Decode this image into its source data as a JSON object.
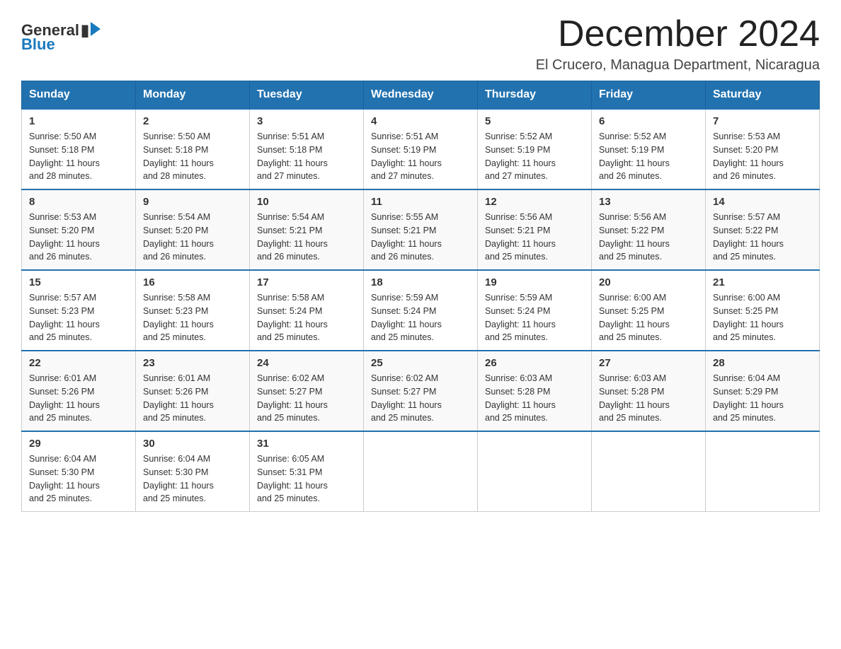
{
  "header": {
    "title": "December 2024",
    "location": "El Crucero, Managua Department, Nicaragua",
    "logo_general": "General",
    "logo_blue": "Blue"
  },
  "days_of_week": [
    "Sunday",
    "Monday",
    "Tuesday",
    "Wednesday",
    "Thursday",
    "Friday",
    "Saturday"
  ],
  "weeks": [
    [
      {
        "day": "1",
        "sunrise": "5:50 AM",
        "sunset": "5:18 PM",
        "daylight": "11 hours and 28 minutes."
      },
      {
        "day": "2",
        "sunrise": "5:50 AM",
        "sunset": "5:18 PM",
        "daylight": "11 hours and 28 minutes."
      },
      {
        "day": "3",
        "sunrise": "5:51 AM",
        "sunset": "5:18 PM",
        "daylight": "11 hours and 27 minutes."
      },
      {
        "day": "4",
        "sunrise": "5:51 AM",
        "sunset": "5:19 PM",
        "daylight": "11 hours and 27 minutes."
      },
      {
        "day": "5",
        "sunrise": "5:52 AM",
        "sunset": "5:19 PM",
        "daylight": "11 hours and 27 minutes."
      },
      {
        "day": "6",
        "sunrise": "5:52 AM",
        "sunset": "5:19 PM",
        "daylight": "11 hours and 26 minutes."
      },
      {
        "day": "7",
        "sunrise": "5:53 AM",
        "sunset": "5:20 PM",
        "daylight": "11 hours and 26 minutes."
      }
    ],
    [
      {
        "day": "8",
        "sunrise": "5:53 AM",
        "sunset": "5:20 PM",
        "daylight": "11 hours and 26 minutes."
      },
      {
        "day": "9",
        "sunrise": "5:54 AM",
        "sunset": "5:20 PM",
        "daylight": "11 hours and 26 minutes."
      },
      {
        "day": "10",
        "sunrise": "5:54 AM",
        "sunset": "5:21 PM",
        "daylight": "11 hours and 26 minutes."
      },
      {
        "day": "11",
        "sunrise": "5:55 AM",
        "sunset": "5:21 PM",
        "daylight": "11 hours and 26 minutes."
      },
      {
        "day": "12",
        "sunrise": "5:56 AM",
        "sunset": "5:21 PM",
        "daylight": "11 hours and 25 minutes."
      },
      {
        "day": "13",
        "sunrise": "5:56 AM",
        "sunset": "5:22 PM",
        "daylight": "11 hours and 25 minutes."
      },
      {
        "day": "14",
        "sunrise": "5:57 AM",
        "sunset": "5:22 PM",
        "daylight": "11 hours and 25 minutes."
      }
    ],
    [
      {
        "day": "15",
        "sunrise": "5:57 AM",
        "sunset": "5:23 PM",
        "daylight": "11 hours and 25 minutes."
      },
      {
        "day": "16",
        "sunrise": "5:58 AM",
        "sunset": "5:23 PM",
        "daylight": "11 hours and 25 minutes."
      },
      {
        "day": "17",
        "sunrise": "5:58 AM",
        "sunset": "5:24 PM",
        "daylight": "11 hours and 25 minutes."
      },
      {
        "day": "18",
        "sunrise": "5:59 AM",
        "sunset": "5:24 PM",
        "daylight": "11 hours and 25 minutes."
      },
      {
        "day": "19",
        "sunrise": "5:59 AM",
        "sunset": "5:24 PM",
        "daylight": "11 hours and 25 minutes."
      },
      {
        "day": "20",
        "sunrise": "6:00 AM",
        "sunset": "5:25 PM",
        "daylight": "11 hours and 25 minutes."
      },
      {
        "day": "21",
        "sunrise": "6:00 AM",
        "sunset": "5:25 PM",
        "daylight": "11 hours and 25 minutes."
      }
    ],
    [
      {
        "day": "22",
        "sunrise": "6:01 AM",
        "sunset": "5:26 PM",
        "daylight": "11 hours and 25 minutes."
      },
      {
        "day": "23",
        "sunrise": "6:01 AM",
        "sunset": "5:26 PM",
        "daylight": "11 hours and 25 minutes."
      },
      {
        "day": "24",
        "sunrise": "6:02 AM",
        "sunset": "5:27 PM",
        "daylight": "11 hours and 25 minutes."
      },
      {
        "day": "25",
        "sunrise": "6:02 AM",
        "sunset": "5:27 PM",
        "daylight": "11 hours and 25 minutes."
      },
      {
        "day": "26",
        "sunrise": "6:03 AM",
        "sunset": "5:28 PM",
        "daylight": "11 hours and 25 minutes."
      },
      {
        "day": "27",
        "sunrise": "6:03 AM",
        "sunset": "5:28 PM",
        "daylight": "11 hours and 25 minutes."
      },
      {
        "day": "28",
        "sunrise": "6:04 AM",
        "sunset": "5:29 PM",
        "daylight": "11 hours and 25 minutes."
      }
    ],
    [
      {
        "day": "29",
        "sunrise": "6:04 AM",
        "sunset": "5:30 PM",
        "daylight": "11 hours and 25 minutes."
      },
      {
        "day": "30",
        "sunrise": "6:04 AM",
        "sunset": "5:30 PM",
        "daylight": "11 hours and 25 minutes."
      },
      {
        "day": "31",
        "sunrise": "6:05 AM",
        "sunset": "5:31 PM",
        "daylight": "11 hours and 25 minutes."
      },
      null,
      null,
      null,
      null
    ]
  ],
  "labels": {
    "sunrise": "Sunrise:",
    "sunset": "Sunset:",
    "daylight": "Daylight:"
  }
}
